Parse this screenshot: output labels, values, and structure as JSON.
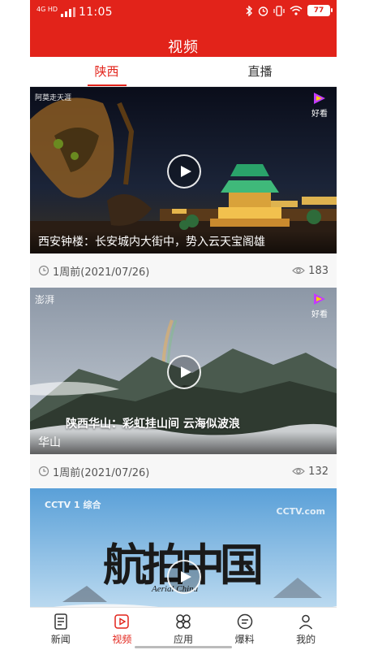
{
  "status_bar": {
    "network": "4G HD",
    "time": "11:05",
    "battery": "77"
  },
  "header": {
    "title": "视频"
  },
  "tabs": [
    {
      "label": "陕西",
      "active": true
    },
    {
      "label": "直播",
      "active": false
    }
  ],
  "videos": [
    {
      "title": "西安钟楼：长安城内大街中，势入云天宝阁雄",
      "time_ago": "1周前(2021/07/26)",
      "views": "183",
      "watermark": "阿莫走天涯",
      "badge": "好看"
    },
    {
      "title": "华山",
      "caption": "陕西华山：彩虹挂山间 云海似波浪",
      "time_ago": "1周前(2021/07/26)",
      "views": "132",
      "watermark": "澎湃",
      "badge": "好看"
    },
    {
      "logo_text": "CCTV 1 综合",
      "logo_right": "CCTV.com",
      "title_cn": "航拍中国",
      "title_en": "Aerial China"
    }
  ],
  "bottom_nav": [
    {
      "label": "新闻",
      "icon": "news-icon",
      "active": false
    },
    {
      "label": "视频",
      "icon": "video-icon",
      "active": true
    },
    {
      "label": "应用",
      "icon": "apps-icon",
      "active": false
    },
    {
      "label": "爆料",
      "icon": "tip-off-icon",
      "active": false
    },
    {
      "label": "我的",
      "icon": "profile-icon",
      "active": false
    }
  ],
  "colors": {
    "accent": "#e2231a",
    "text": "#333333"
  }
}
